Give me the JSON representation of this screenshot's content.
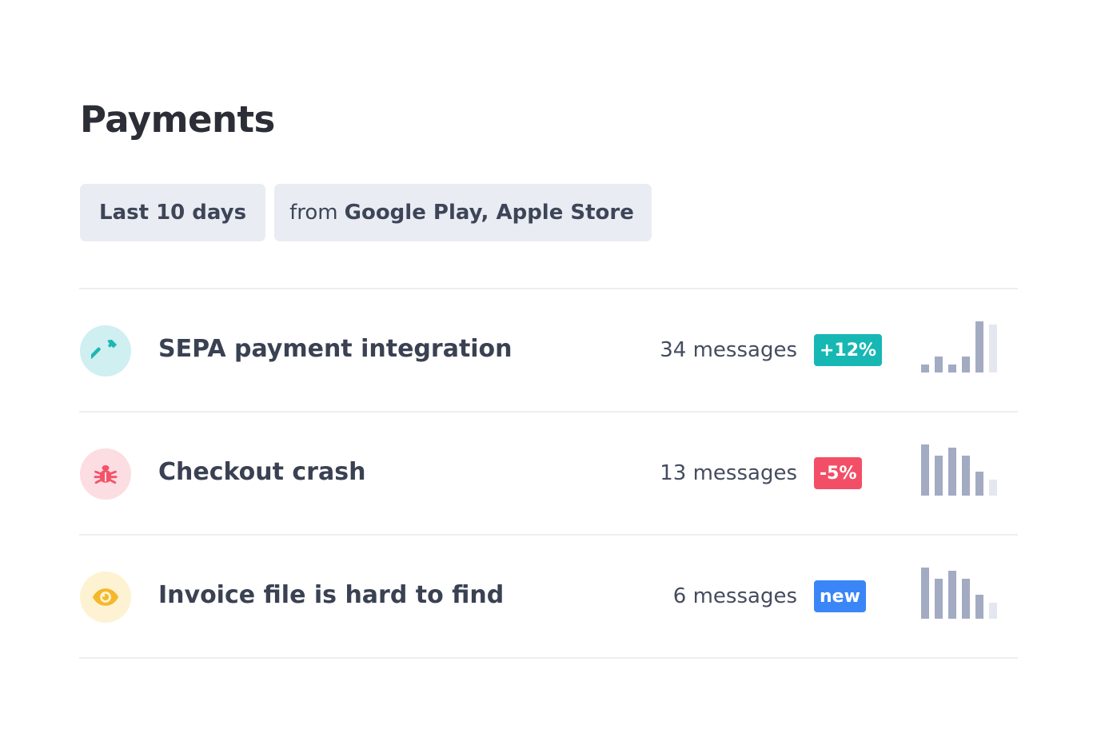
{
  "page": {
    "title": "Payments"
  },
  "filters": {
    "date_range": "Last 10 days",
    "source_prefix": "from",
    "source_value": "Google Play, Apple Store"
  },
  "colors": {
    "spark_bar": "#a3abc3",
    "spark_bar_current": "#e4e7f0",
    "positive": "#17b7b3",
    "negative": "#f24f67",
    "new": "#3a86f7"
  },
  "topics": [
    {
      "title": "SEPA payment integration",
      "count": "34 messages",
      "badge": "+12%",
      "badge_kind": "positive",
      "icon": "hammer-icon",
      "icon_color": "#1eb6b3",
      "icon_bg": "#cfeff0",
      "trend": [
        1,
        2,
        1,
        2,
        6.4,
        6
      ]
    },
    {
      "title": "Checkout crash",
      "count": "13 messages",
      "badge": "-5%",
      "badge_kind": "negative",
      "icon": "bug-icon",
      "icon_color": "#f2546a",
      "icon_bg": "#fcdde2",
      "trend": [
        6.4,
        5,
        6,
        5,
        3,
        2
      ]
    },
    {
      "title": "Invoice file is hard to find",
      "count": "6 messages",
      "badge": "new",
      "badge_kind": "new",
      "icon": "eye-icon",
      "icon_color": "#f5b72c",
      "icon_bg": "#fdf3d2",
      "trend": [
        6.4,
        5,
        6,
        5,
        3,
        2
      ]
    }
  ]
}
